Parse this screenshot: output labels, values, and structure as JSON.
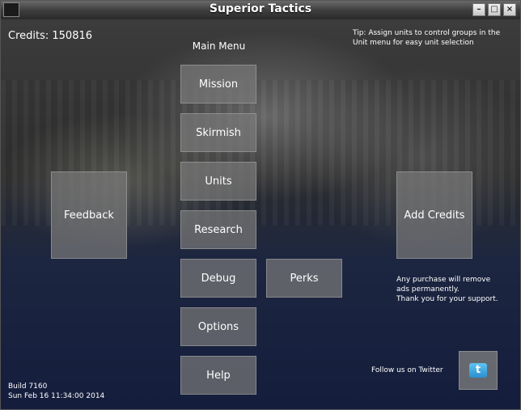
{
  "window": {
    "title": "Superior Tactics",
    "controls": {
      "minimize": "–",
      "maximize": "□",
      "close": "×"
    }
  },
  "hud": {
    "credits_label": "Credits:",
    "credits_value": "150816",
    "tip": "Tip: Assign units to control groups in the Unit menu for easy unit selection"
  },
  "menu": {
    "title": "Main Menu",
    "buttons": {
      "mission": "Mission",
      "skirmish": "Skirmish",
      "units": "Units",
      "research": "Research",
      "debug": "Debug",
      "perks": "Perks",
      "options": "Options",
      "help": "Help"
    }
  },
  "side": {
    "feedback": "Feedback",
    "add_credits": "Add Credits",
    "purchase_note_line1": "Any purchase will remove",
    "purchase_note_line2": "ads permanently.",
    "purchase_note_line3": "Thank you for your support."
  },
  "footer": {
    "build": "Build 7160",
    "date": "Sun Feb 16 11:34:00 2014",
    "follow": "Follow us on Twitter",
    "twitter_icon": "twitter-icon",
    "twitter_glyph": "t"
  },
  "colors": {
    "button_bg": "#787878",
    "text": "#ffffff",
    "twitter": "#3aa0dc"
  }
}
